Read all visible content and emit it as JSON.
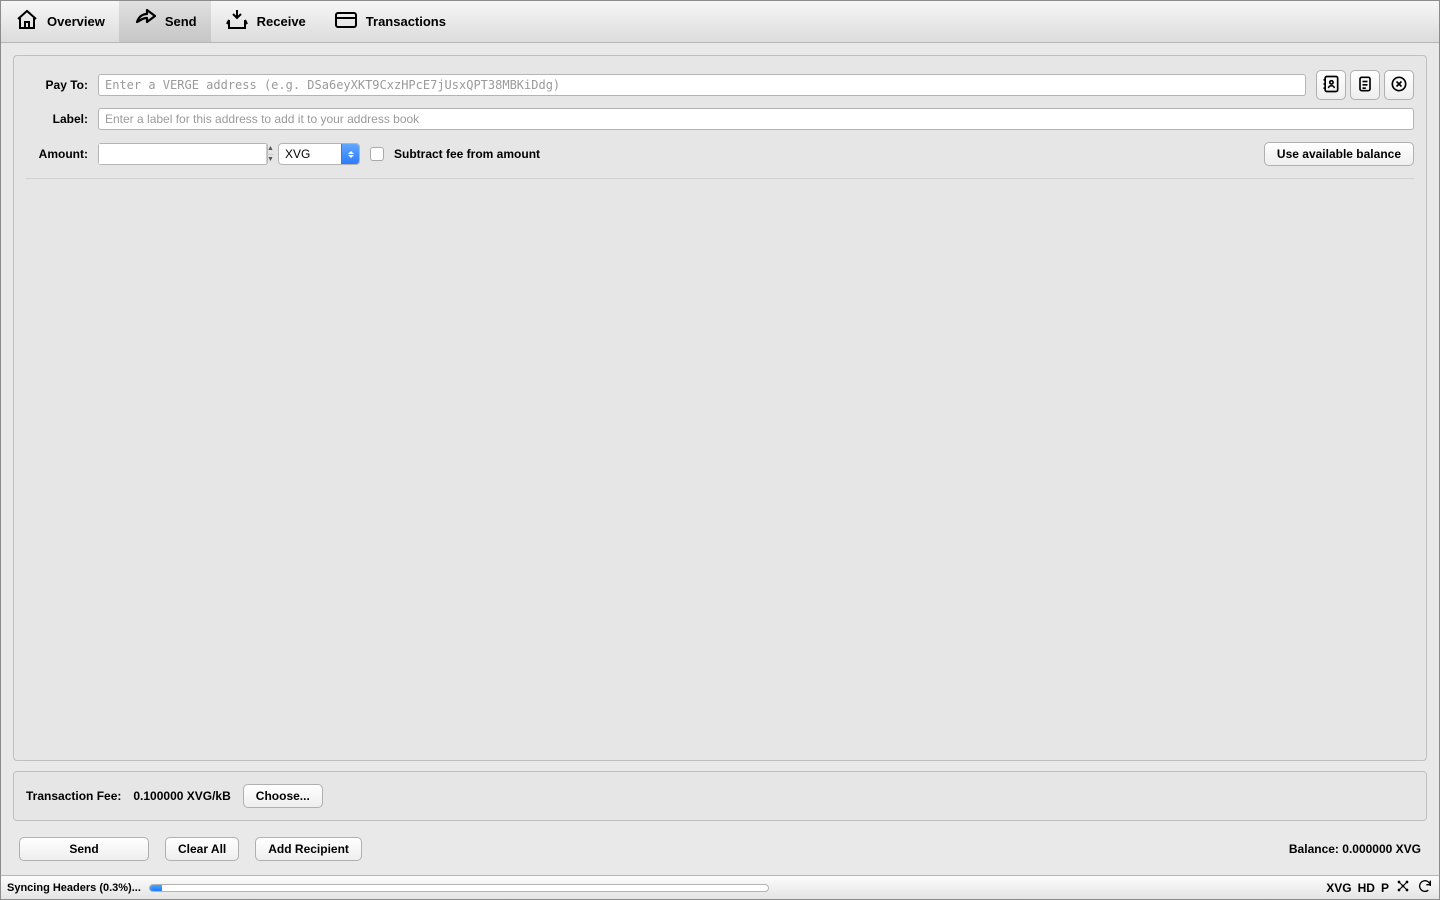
{
  "tabs": {
    "overview": "Overview",
    "send": "Send",
    "receive": "Receive",
    "transactions": "Transactions"
  },
  "form": {
    "payto_label": "Pay To:",
    "payto_placeholder": "Enter a VERGE address (e.g. DSa6eyXKT9CxzHPcE7jUsxQPT38MBKiDdg)",
    "label_label": "Label:",
    "label_placeholder": "Enter a label for this address to add it to your address book",
    "amount_label": "Amount:",
    "amount_value": "",
    "unit": "XVG",
    "subtract_fee_label": "Subtract fee from amount",
    "use_available_balance": "Use available balance"
  },
  "fee": {
    "label": "Transaction Fee:",
    "value": "0.100000 XVG/kB",
    "choose": "Choose..."
  },
  "actions": {
    "send": "Send",
    "clear": "Clear All",
    "add": "Add Recipient"
  },
  "balance": {
    "label": "Balance:",
    "value": "0.000000 XVG"
  },
  "status": {
    "sync_text": "Syncing Headers (0.3%)...",
    "progress_percent": 2,
    "unit": "XVG",
    "hd": "HD",
    "p": "P"
  }
}
